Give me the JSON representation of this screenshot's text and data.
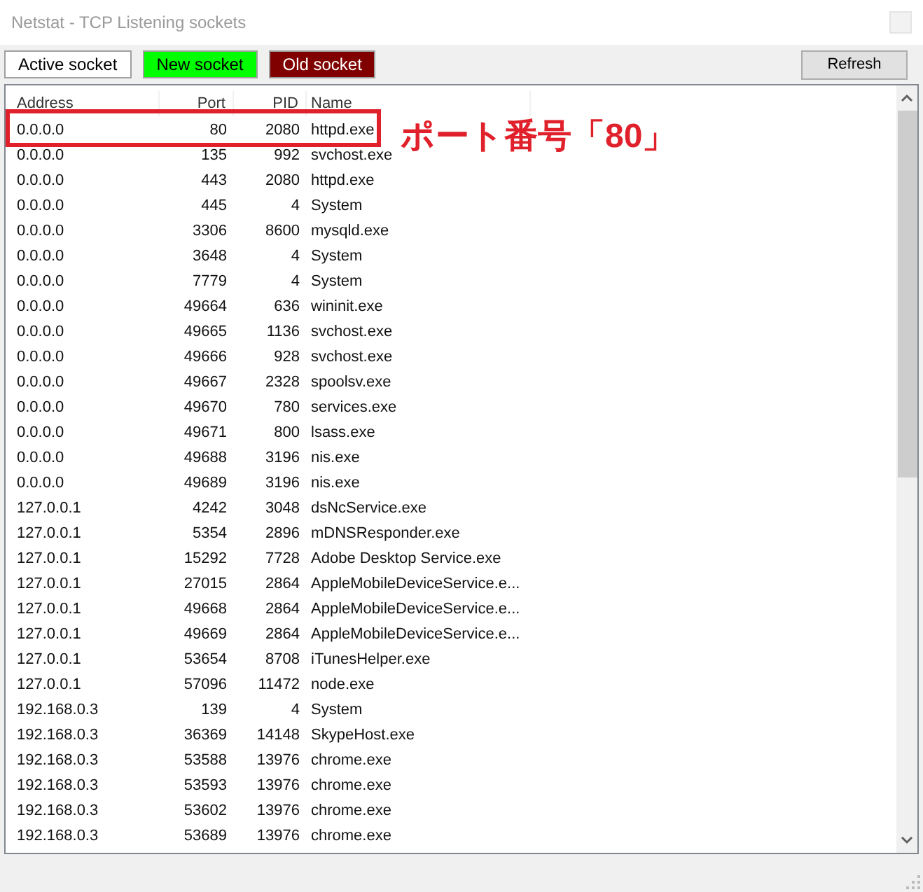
{
  "window": {
    "title": "Netstat - TCP Listening sockets"
  },
  "legend": [
    {
      "label": "Active socket",
      "color": "#ffffff"
    },
    {
      "label": "New socket",
      "color": "#00ff00"
    },
    {
      "label": "Old socket",
      "color": "#800000"
    }
  ],
  "refresh_button": "Refresh",
  "table": {
    "columns": [
      {
        "label": "Address",
        "kind": "text"
      },
      {
        "label": "Port",
        "kind": "number"
      },
      {
        "label": "PID",
        "kind": "number"
      },
      {
        "label": "Name",
        "kind": "text"
      }
    ],
    "rows": [
      [
        "0.0.0.0",
        "80",
        "2080",
        "httpd.exe"
      ],
      [
        "0.0.0.0",
        "135",
        "992",
        "svchost.exe"
      ],
      [
        "0.0.0.0",
        "443",
        "2080",
        "httpd.exe"
      ],
      [
        "0.0.0.0",
        "445",
        "4",
        "System"
      ],
      [
        "0.0.0.0",
        "3306",
        "8600",
        "mysqld.exe"
      ],
      [
        "0.0.0.0",
        "3648",
        "4",
        "System"
      ],
      [
        "0.0.0.0",
        "7779",
        "4",
        "System"
      ],
      [
        "0.0.0.0",
        "49664",
        "636",
        "wininit.exe"
      ],
      [
        "0.0.0.0",
        "49665",
        "1136",
        "svchost.exe"
      ],
      [
        "0.0.0.0",
        "49666",
        "928",
        "svchost.exe"
      ],
      [
        "0.0.0.0",
        "49667",
        "2328",
        "spoolsv.exe"
      ],
      [
        "0.0.0.0",
        "49670",
        "780",
        "services.exe"
      ],
      [
        "0.0.0.0",
        "49671",
        "800",
        "lsass.exe"
      ],
      [
        "0.0.0.0",
        "49688",
        "3196",
        "nis.exe"
      ],
      [
        "0.0.0.0",
        "49689",
        "3196",
        "nis.exe"
      ],
      [
        "127.0.0.1",
        "4242",
        "3048",
        "dsNcService.exe"
      ],
      [
        "127.0.0.1",
        "5354",
        "2896",
        "mDNSResponder.exe"
      ],
      [
        "127.0.0.1",
        "15292",
        "7728",
        "Adobe Desktop Service.exe"
      ],
      [
        "127.0.0.1",
        "27015",
        "2864",
        "AppleMobileDeviceService.e..."
      ],
      [
        "127.0.0.1",
        "49668",
        "2864",
        "AppleMobileDeviceService.e..."
      ],
      [
        "127.0.0.1",
        "49669",
        "2864",
        "AppleMobileDeviceService.e..."
      ],
      [
        "127.0.0.1",
        "53654",
        "8708",
        "iTunesHelper.exe"
      ],
      [
        "127.0.0.1",
        "57096",
        "11472",
        "node.exe"
      ],
      [
        "192.168.0.3",
        "139",
        "4",
        "System"
      ],
      [
        "192.168.0.3",
        "36369",
        "14148",
        "SkypeHost.exe"
      ],
      [
        "192.168.0.3",
        "53588",
        "13976",
        "chrome.exe"
      ],
      [
        "192.168.0.3",
        "53593",
        "13976",
        "chrome.exe"
      ],
      [
        "192.168.0.3",
        "53602",
        "13976",
        "chrome.exe"
      ],
      [
        "192.168.0.3",
        "53689",
        "13976",
        "chrome.exe"
      ]
    ]
  },
  "annotation": {
    "label": "ポート番号「80」"
  }
}
